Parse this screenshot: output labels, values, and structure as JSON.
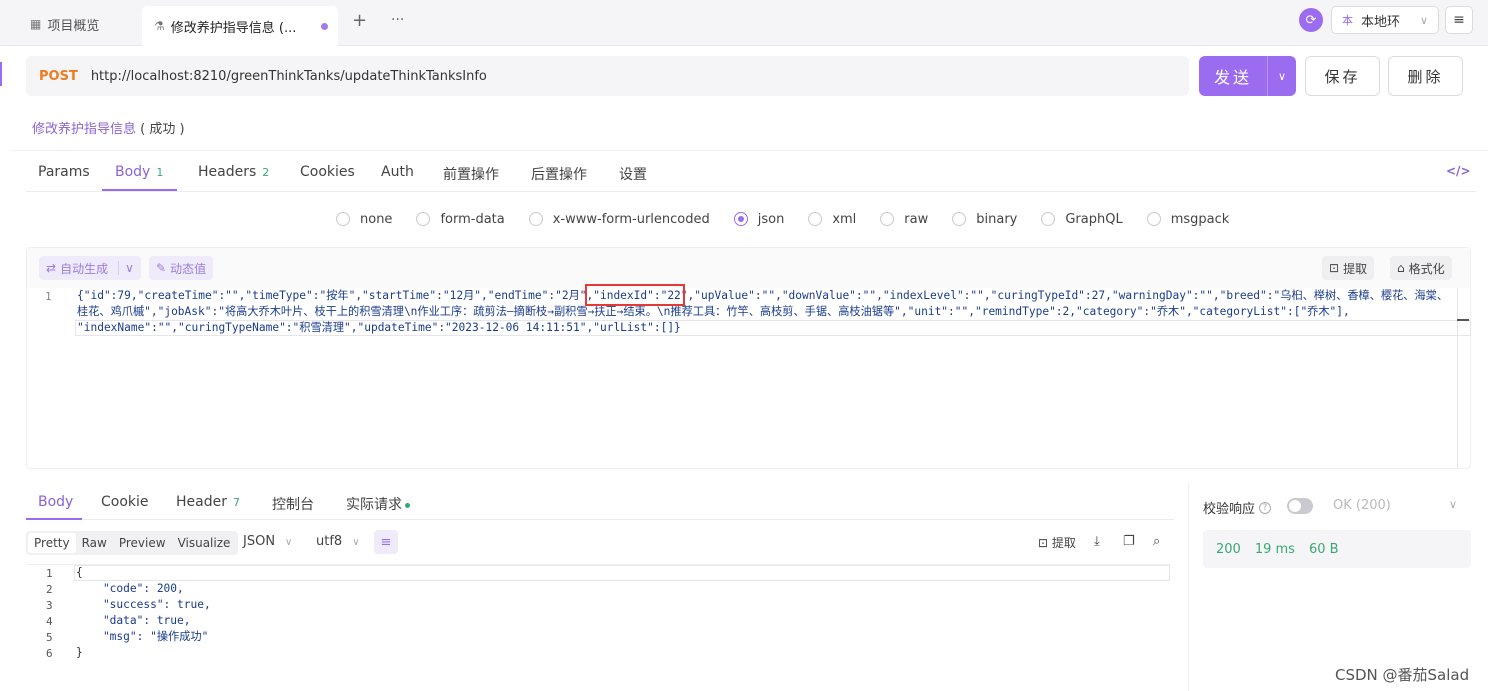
{
  "tabs": {
    "overview": "项目概览",
    "active": "修改养护指导信息 (...",
    "add": "+",
    "more": "···"
  },
  "env": {
    "badge": "本",
    "label": "本地环"
  },
  "request": {
    "method": "POST",
    "url": "http://localhost:8210/greenThinkTanks/updateThinkTanksInfo",
    "send": "发送",
    "save": "保存",
    "delete": "删除",
    "name": "修改养护指导信息",
    "status": "( 成功 )"
  },
  "reqtabs": [
    {
      "label": "Params",
      "count": ""
    },
    {
      "label": "Body",
      "count": "1"
    },
    {
      "label": "Headers",
      "count": "2"
    },
    {
      "label": "Cookies",
      "count": ""
    },
    {
      "label": "Auth",
      "count": ""
    },
    {
      "label": "前置操作",
      "count": ""
    },
    {
      "label": "后置操作",
      "count": ""
    },
    {
      "label": "设置",
      "count": ""
    }
  ],
  "bodytypes": [
    "none",
    "form-data",
    "x-www-form-urlencoded",
    "json",
    "xml",
    "raw",
    "binary",
    "GraphQL",
    "msgpack"
  ],
  "selected_bodytype": "json",
  "editor": {
    "autogen": "自动生成",
    "dynamic": "动态值",
    "extract": "提取",
    "format": "格式化",
    "line_no": "1",
    "lines": [
      "{\"id\":79,\"createTime\":\"\",\"timeType\":\"按年\",\"startTime\":\"12月\",\"endTime\":\"2月\",\"indexId\":\"22\",\"upValue\":\"\",\"downValue\":\"\",\"indexLevel\":\"\",\"curingTypeId\":27,\"warningDay\":\"\",\"breed\":\"乌桕、榉树、香樟、樱花、海棠、",
      "桂花、鸡爪槭\",\"jobAsk\":\"将高大乔木叶片、枝干上的积雪清理\\n作业工序：疏剪法—摘断枝→副积雪→扶正→结束。\\n推荐工具：竹竿、高枝剪、手锯、高枝油锯等\",\"unit\":\"\",\"remindType\":2,\"category\":\"乔木\",\"categoryList\":[\"乔木\"],",
      "\"indexName\":\"\",\"curingTypeName\":\"积雪清理\",\"updateTime\":\"2023-12-06 14:11:51\",\"urlList\":[]}"
    ]
  },
  "resptabs": [
    {
      "label": "Body",
      "count": ""
    },
    {
      "label": "Cookie",
      "count": ""
    },
    {
      "label": "Header",
      "count": "7"
    },
    {
      "label": "控制台",
      "count": ""
    },
    {
      "label": "实际请求",
      "count": ""
    }
  ],
  "viewmodes": [
    "Pretty",
    "Raw",
    "Preview",
    "Visualize"
  ],
  "resp_format": "JSON",
  "resp_encoding": "utf8",
  "resp_extract": "提取",
  "response_lines": [
    "{",
    "    \"code\": 200,",
    "    \"success\": true,",
    "    \"data\": true,",
    "    \"msg\": \"操作成功\"",
    "}"
  ],
  "response_line_numbers": [
    "1",
    "2",
    "3",
    "4",
    "5",
    "6"
  ],
  "validation": {
    "label": "校验响应",
    "status": "OK (200)",
    "code": "200",
    "time": "19 ms",
    "size": "60 B"
  },
  "watermark": "CSDN @番茄Salad",
  "colors": {
    "accent": "#9b6cf0",
    "method": "#f07b1c",
    "success": "#3aa872",
    "highlight": "#e53935"
  }
}
